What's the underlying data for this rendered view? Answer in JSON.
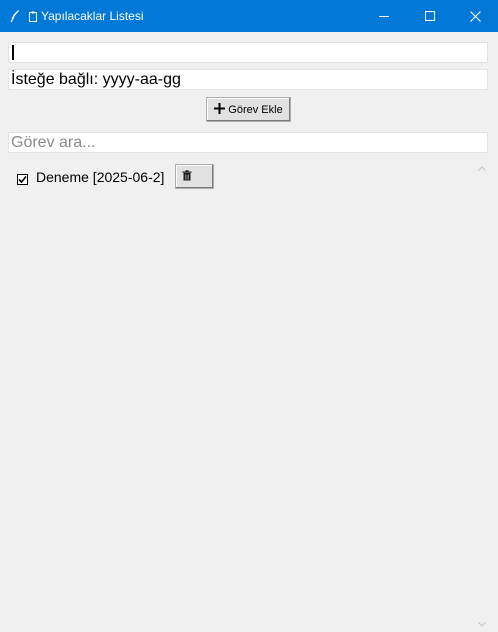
{
  "window": {
    "title": "Yapılacaklar Listesi",
    "title_color": "#0078d7",
    "icons": {
      "app": "feather-icon",
      "title_glyph": "clipboard-icon",
      "minimize": "minimize-icon",
      "maximize": "maximize-icon",
      "close": "close-icon"
    }
  },
  "task_input": {
    "value": ""
  },
  "date_input": {
    "value": "İsteğe bağlı: yyyy-aa-gg"
  },
  "add_button": {
    "label": "Görev Ekle",
    "icon": "plus-icon"
  },
  "search_input": {
    "placeholder": "Görev ara..."
  },
  "tasks": [
    {
      "label": "Deneme [2025-06-2]",
      "checked": true,
      "delete_icon": "trash-icon"
    }
  ],
  "scrollbar": {
    "up_icon": "chevron-up-icon",
    "down_icon": "chevron-down-icon"
  }
}
